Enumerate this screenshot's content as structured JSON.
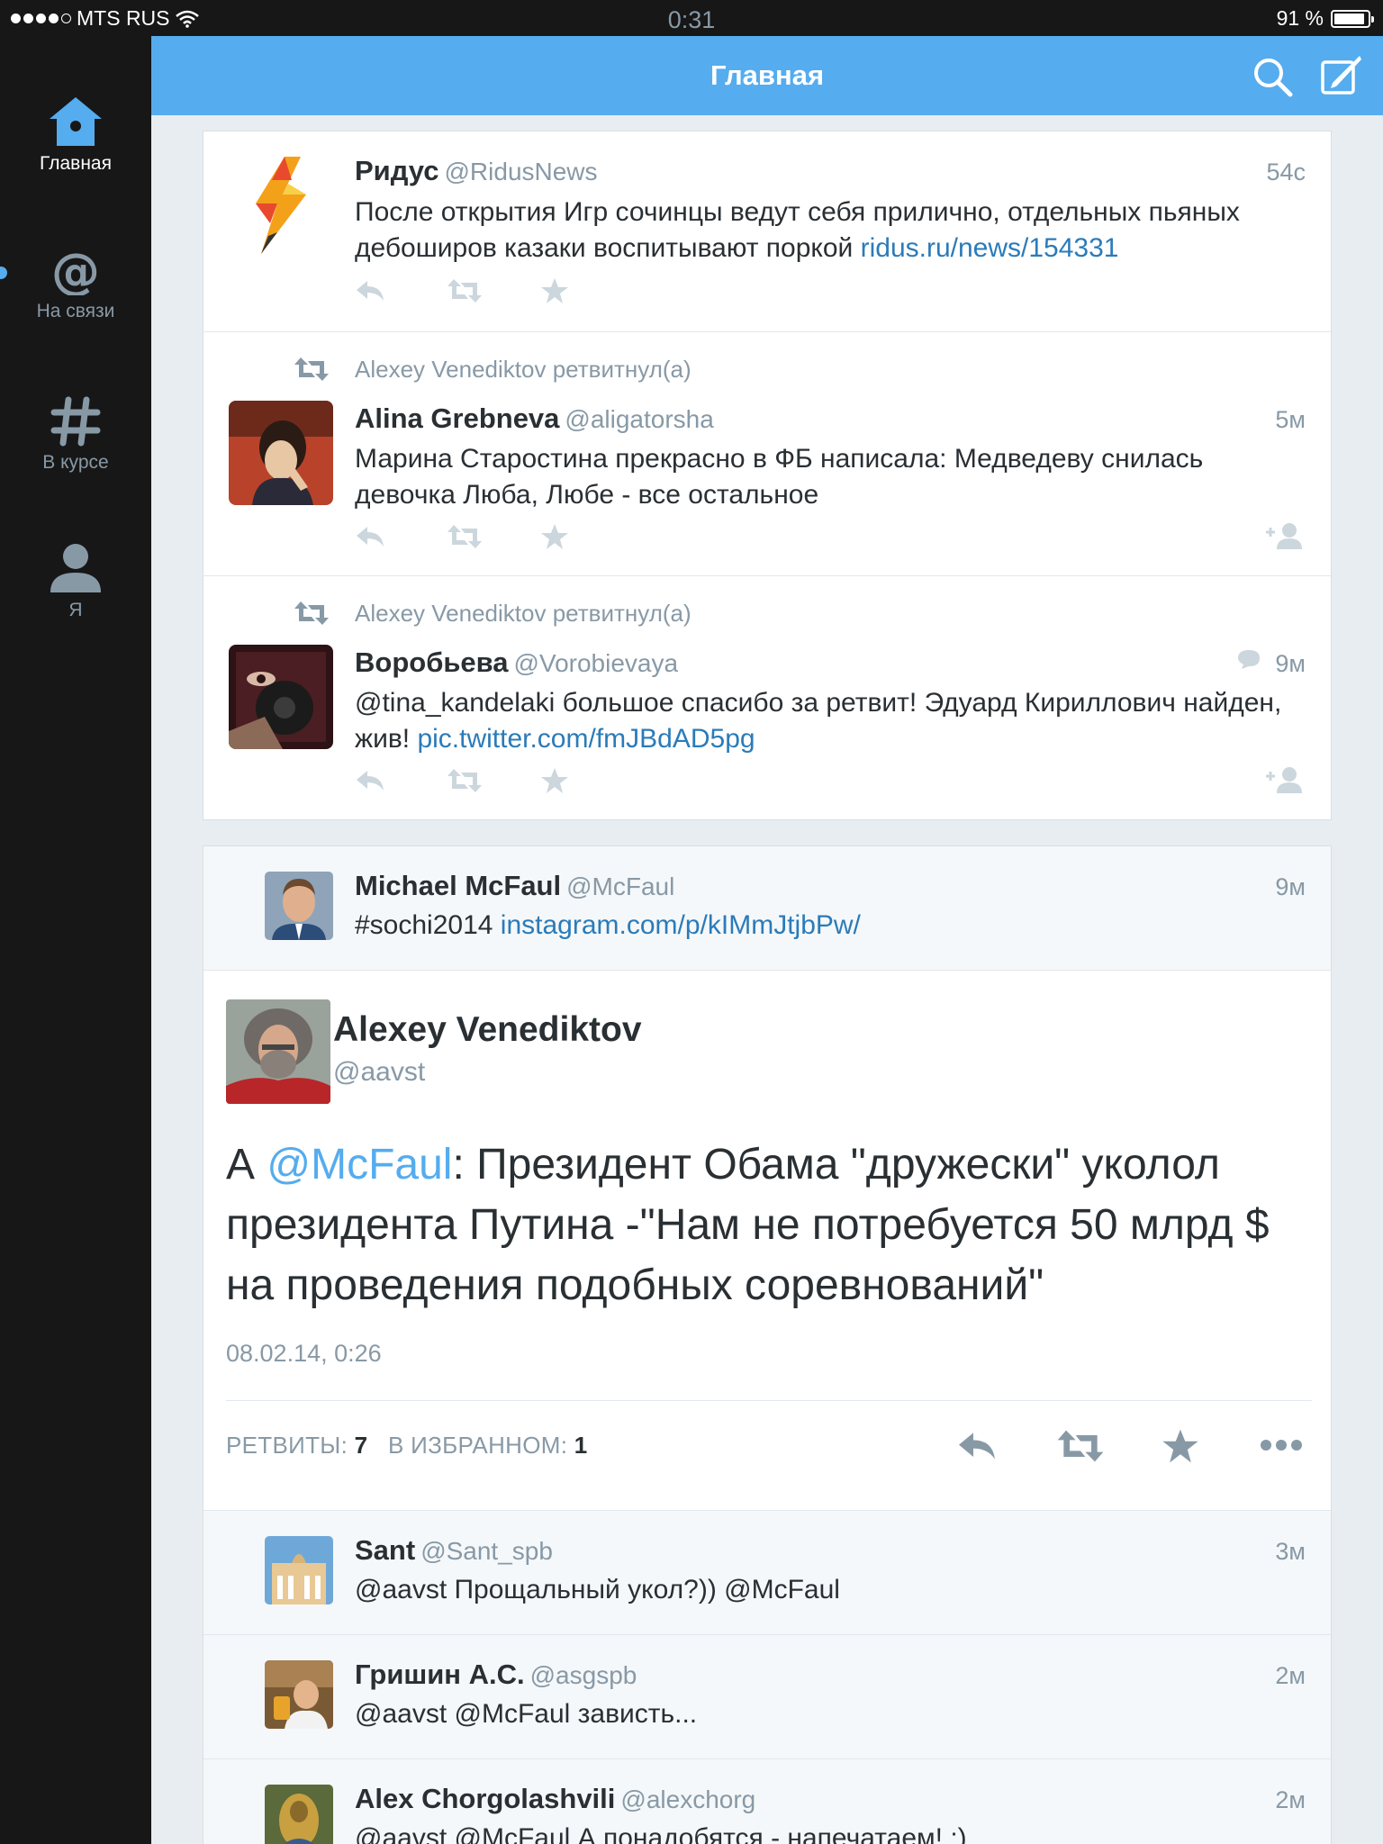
{
  "status_bar": {
    "carrier": "MTS RUS",
    "time": "0:31",
    "battery": "91 %",
    "battery_level": 0.91,
    "signal_bars": 4,
    "signal_max": 5
  },
  "sidebar": {
    "items": [
      {
        "label": "Главная",
        "icon": "home-icon",
        "active": true
      },
      {
        "label": "На связи",
        "icon": "at-icon",
        "active": false
      },
      {
        "label": "В курсе",
        "icon": "hashtag-icon",
        "active": false
      },
      {
        "label": "Я",
        "icon": "person-icon",
        "active": false
      }
    ]
  },
  "header": {
    "title": "Главная",
    "search_icon": "search-icon",
    "compose_icon": "compose-icon"
  },
  "colors": {
    "accent": "#55acee",
    "link": "#2b7bb9",
    "muted": "#8899a6",
    "text": "#292f33"
  },
  "timeline": [
    {
      "name": "Ридус",
      "handle": "@RidusNews",
      "time": "54с",
      "text": "После открытия Игр сочинцы ведут себя прилично, отдельных пьяных дебоширов казаки воспитывают поркой ",
      "link": "ridus.ru/news/154331"
    },
    {
      "retweeted_by": "Alexey Venediktov ретвитнул(а)",
      "name": "Alina Grebneva",
      "handle": "@aligatorsha",
      "time": "5м",
      "text": "Марина Старостина прекрасно в ФБ написала: Медведеву снилась девочка Люба, Любе - все остальное"
    },
    {
      "retweeted_by": "Alexey Venediktov ретвитнул(а)",
      "name": "Воробьева",
      "handle": "@Vorobievaya",
      "time": "9м",
      "text": "@tina_kandelaki большое спасибо за ретвит! Эдуард Кириллович найден, жив! ",
      "link": "pic.twitter.com/fmJBdAD5pg"
    }
  ],
  "conversation": {
    "parent": {
      "name": "Michael McFaul",
      "handle": "@McFaul",
      "time": "9м",
      "text": "#sochi2014 ",
      "link": "instagram.com/p/kIMmJtjbPw/"
    },
    "detail": {
      "name": "Alexey Venediktov",
      "handle": "@aavst",
      "text_prefix": "А ",
      "mention": "@McFaul",
      "text_rest": ":  Президент Обама \"дружески\" уколол президента Путина -\"Нам не потребуется 50 млрд $ на проведения подобных соревнований\"",
      "date": "08.02.14, 0:26",
      "retweets_label": "РЕТВИТЫ:",
      "retweets": "7",
      "favorites_label": "В ИЗБРАННОМ:",
      "favorites": "1"
    },
    "replies": [
      {
        "name": "Sant",
        "handle": "@Sant_spb",
        "time": "3м",
        "text": "@aavst Прощальный укол?)) @McFaul"
      },
      {
        "name": "Гришин А.С.",
        "handle": "@asgspb",
        "time": "2м",
        "text": "@aavst @McFaul зависть..."
      },
      {
        "name": "Alex Chorgolashvili",
        "handle": "@alexchorg",
        "time": "2м",
        "text": "@aavst @McFaul А понадобятся - напечатаем! :)"
      }
    ]
  }
}
